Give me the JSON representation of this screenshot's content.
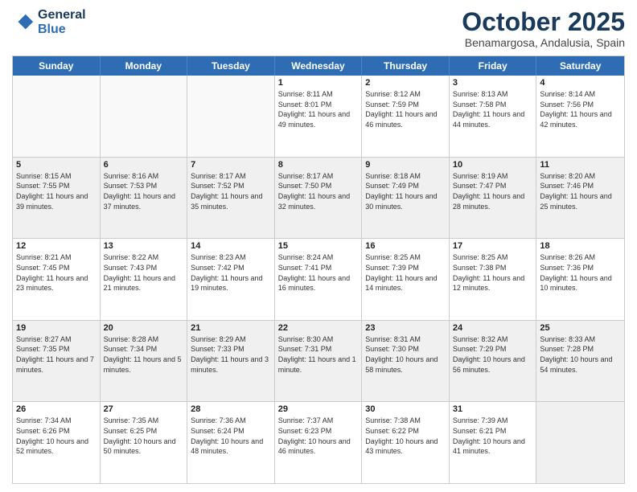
{
  "header": {
    "logo_line1": "General",
    "logo_line2": "Blue",
    "month": "October 2025",
    "location": "Benamargosa, Andalusia, Spain"
  },
  "days_of_week": [
    "Sunday",
    "Monday",
    "Tuesday",
    "Wednesday",
    "Thursday",
    "Friday",
    "Saturday"
  ],
  "weeks": [
    [
      {
        "day": "",
        "info": ""
      },
      {
        "day": "",
        "info": ""
      },
      {
        "day": "",
        "info": ""
      },
      {
        "day": "1",
        "info": "Sunrise: 8:11 AM\nSunset: 8:01 PM\nDaylight: 11 hours and 49 minutes."
      },
      {
        "day": "2",
        "info": "Sunrise: 8:12 AM\nSunset: 7:59 PM\nDaylight: 11 hours and 46 minutes."
      },
      {
        "day": "3",
        "info": "Sunrise: 8:13 AM\nSunset: 7:58 PM\nDaylight: 11 hours and 44 minutes."
      },
      {
        "day": "4",
        "info": "Sunrise: 8:14 AM\nSunset: 7:56 PM\nDaylight: 11 hours and 42 minutes."
      }
    ],
    [
      {
        "day": "5",
        "info": "Sunrise: 8:15 AM\nSunset: 7:55 PM\nDaylight: 11 hours and 39 minutes."
      },
      {
        "day": "6",
        "info": "Sunrise: 8:16 AM\nSunset: 7:53 PM\nDaylight: 11 hours and 37 minutes."
      },
      {
        "day": "7",
        "info": "Sunrise: 8:17 AM\nSunset: 7:52 PM\nDaylight: 11 hours and 35 minutes."
      },
      {
        "day": "8",
        "info": "Sunrise: 8:17 AM\nSunset: 7:50 PM\nDaylight: 11 hours and 32 minutes."
      },
      {
        "day": "9",
        "info": "Sunrise: 8:18 AM\nSunset: 7:49 PM\nDaylight: 11 hours and 30 minutes."
      },
      {
        "day": "10",
        "info": "Sunrise: 8:19 AM\nSunset: 7:47 PM\nDaylight: 11 hours and 28 minutes."
      },
      {
        "day": "11",
        "info": "Sunrise: 8:20 AM\nSunset: 7:46 PM\nDaylight: 11 hours and 25 minutes."
      }
    ],
    [
      {
        "day": "12",
        "info": "Sunrise: 8:21 AM\nSunset: 7:45 PM\nDaylight: 11 hours and 23 minutes."
      },
      {
        "day": "13",
        "info": "Sunrise: 8:22 AM\nSunset: 7:43 PM\nDaylight: 11 hours and 21 minutes."
      },
      {
        "day": "14",
        "info": "Sunrise: 8:23 AM\nSunset: 7:42 PM\nDaylight: 11 hours and 19 minutes."
      },
      {
        "day": "15",
        "info": "Sunrise: 8:24 AM\nSunset: 7:41 PM\nDaylight: 11 hours and 16 minutes."
      },
      {
        "day": "16",
        "info": "Sunrise: 8:25 AM\nSunset: 7:39 PM\nDaylight: 11 hours and 14 minutes."
      },
      {
        "day": "17",
        "info": "Sunrise: 8:25 AM\nSunset: 7:38 PM\nDaylight: 11 hours and 12 minutes."
      },
      {
        "day": "18",
        "info": "Sunrise: 8:26 AM\nSunset: 7:36 PM\nDaylight: 11 hours and 10 minutes."
      }
    ],
    [
      {
        "day": "19",
        "info": "Sunrise: 8:27 AM\nSunset: 7:35 PM\nDaylight: 11 hours and 7 minutes."
      },
      {
        "day": "20",
        "info": "Sunrise: 8:28 AM\nSunset: 7:34 PM\nDaylight: 11 hours and 5 minutes."
      },
      {
        "day": "21",
        "info": "Sunrise: 8:29 AM\nSunset: 7:33 PM\nDaylight: 11 hours and 3 minutes."
      },
      {
        "day": "22",
        "info": "Sunrise: 8:30 AM\nSunset: 7:31 PM\nDaylight: 11 hours and 1 minute."
      },
      {
        "day": "23",
        "info": "Sunrise: 8:31 AM\nSunset: 7:30 PM\nDaylight: 10 hours and 58 minutes."
      },
      {
        "day": "24",
        "info": "Sunrise: 8:32 AM\nSunset: 7:29 PM\nDaylight: 10 hours and 56 minutes."
      },
      {
        "day": "25",
        "info": "Sunrise: 8:33 AM\nSunset: 7:28 PM\nDaylight: 10 hours and 54 minutes."
      }
    ],
    [
      {
        "day": "26",
        "info": "Sunrise: 7:34 AM\nSunset: 6:26 PM\nDaylight: 10 hours and 52 minutes."
      },
      {
        "day": "27",
        "info": "Sunrise: 7:35 AM\nSunset: 6:25 PM\nDaylight: 10 hours and 50 minutes."
      },
      {
        "day": "28",
        "info": "Sunrise: 7:36 AM\nSunset: 6:24 PM\nDaylight: 10 hours and 48 minutes."
      },
      {
        "day": "29",
        "info": "Sunrise: 7:37 AM\nSunset: 6:23 PM\nDaylight: 10 hours and 46 minutes."
      },
      {
        "day": "30",
        "info": "Sunrise: 7:38 AM\nSunset: 6:22 PM\nDaylight: 10 hours and 43 minutes."
      },
      {
        "day": "31",
        "info": "Sunrise: 7:39 AM\nSunset: 6:21 PM\nDaylight: 10 hours and 41 minutes."
      },
      {
        "day": "",
        "info": ""
      }
    ]
  ]
}
